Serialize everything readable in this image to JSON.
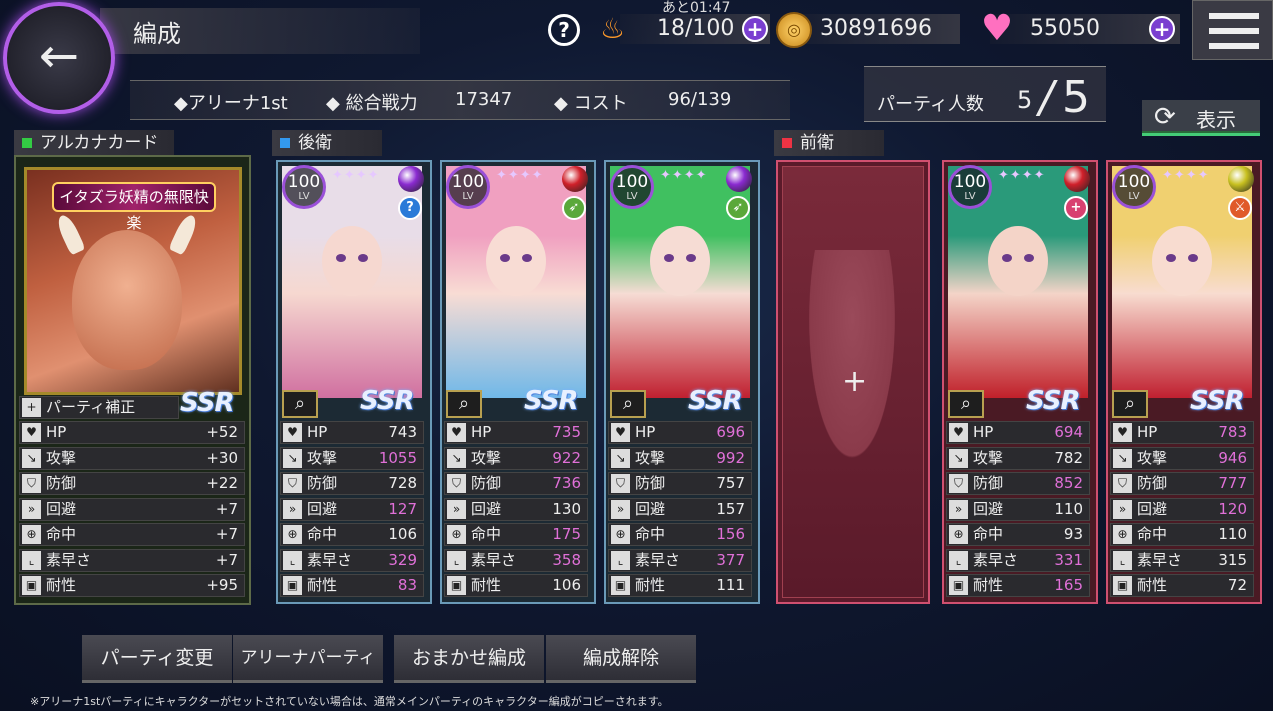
{
  "header": {
    "title": "編成",
    "stamina_timer": "あと01:47",
    "stamina": "18/100",
    "coins": "30891696",
    "gems": "55050"
  },
  "info": {
    "arena": "アリーナ1st",
    "power_label": "総合戦力",
    "power_value": "17347",
    "cost_label": "コスト",
    "cost_value": "96/139"
  },
  "party": {
    "label": "パーティ人数",
    "count": "5",
    "max": "5",
    "display_label": "表示"
  },
  "sections": {
    "arcana": "アルカナカード",
    "rear": "後衛",
    "front": "前衛"
  },
  "arcana": {
    "name": "イタズラ妖精の無限快楽",
    "rarity": "SSR",
    "bonus_label": "パーティ補正",
    "stats": [
      {
        "name": "HP",
        "value": "+52"
      },
      {
        "name": "攻撃",
        "value": "+30"
      },
      {
        "name": "防御",
        "value": "+22"
      },
      {
        "name": "回避",
        "value": "+7"
      },
      {
        "name": "命中",
        "value": "+7"
      },
      {
        "name": "素早さ",
        "value": "+7"
      },
      {
        "name": "耐性",
        "value": "+95"
      }
    ]
  },
  "stat_icons": [
    "heart-icon",
    "sword-icon",
    "shield-icon",
    "chevrons-icon",
    "crosshair-icon",
    "boot-icon",
    "resist-icon"
  ],
  "characters": [
    {
      "lv": "100",
      "lv_label": "LV",
      "rarity": "SSR",
      "orb_color": "#8a2ad0",
      "role_color": "#2a7ad8",
      "role": "?",
      "hair": "#e8dde8",
      "skin": "#f6d8d0",
      "accent": "#d070a0",
      "stats": [
        [
          "HP",
          "743",
          false
        ],
        [
          "攻撃",
          "1055",
          true
        ],
        [
          "防御",
          "728",
          false
        ],
        [
          "回避",
          "127",
          true
        ],
        [
          "命中",
          "106",
          false
        ],
        [
          "素早さ",
          "329",
          true
        ],
        [
          "耐性",
          "83",
          true
        ]
      ]
    },
    {
      "lv": "100",
      "lv_label": "LV",
      "rarity": "SSR",
      "orb_color": "#d0202a",
      "role_color": "#5aa83a",
      "role": "➶",
      "hair": "#f0a0c0",
      "skin": "#f8dcd4",
      "accent": "#70b8e8",
      "stats": [
        [
          "HP",
          "735",
          true
        ],
        [
          "攻撃",
          "922",
          true
        ],
        [
          "防御",
          "736",
          true
        ],
        [
          "回避",
          "130",
          false
        ],
        [
          "命中",
          "175",
          true
        ],
        [
          "素早さ",
          "358",
          true
        ],
        [
          "耐性",
          "106",
          false
        ]
      ]
    },
    {
      "lv": "100",
      "lv_label": "LV",
      "rarity": "SSR",
      "orb_color": "#8a2ad0",
      "role_color": "#5aa83a",
      "role": "➶",
      "hair": "#40c060",
      "skin": "#f6dcd4",
      "accent": "#c02030",
      "stats": [
        [
          "HP",
          "696",
          true
        ],
        [
          "攻撃",
          "992",
          true
        ],
        [
          "防御",
          "757",
          false
        ],
        [
          "回避",
          "157",
          false
        ],
        [
          "命中",
          "156",
          true
        ],
        [
          "素早さ",
          "377",
          true
        ],
        [
          "耐性",
          "111",
          false
        ]
      ]
    },
    {
      "lv": "100",
      "lv_label": "LV",
      "rarity": "SSR",
      "orb_color": "#d0202a",
      "role_color": "#d84070",
      "role": "+",
      "hair": "#2a9a7a",
      "skin": "#f4d4c8",
      "accent": "#c0202a",
      "stats": [
        [
          "HP",
          "694",
          true
        ],
        [
          "攻撃",
          "782",
          false
        ],
        [
          "防御",
          "852",
          true
        ],
        [
          "回避",
          "110",
          false
        ],
        [
          "命中",
          "93",
          false
        ],
        [
          "素早さ",
          "331",
          true
        ],
        [
          "耐性",
          "165",
          true
        ]
      ]
    },
    {
      "lv": "100",
      "lv_label": "LV",
      "rarity": "SSR",
      "orb_color": "#c8c020",
      "role_color": "#e05a2a",
      "role": "⚔",
      "hair": "#f0d070",
      "skin": "#f8dcd0",
      "accent": "#c02030",
      "stats": [
        [
          "HP",
          "783",
          true
        ],
        [
          "攻撃",
          "946",
          true
        ],
        [
          "防御",
          "777",
          true
        ],
        [
          "回避",
          "120",
          true
        ],
        [
          "命中",
          "110",
          false
        ],
        [
          "素早さ",
          "315",
          false
        ],
        [
          "耐性",
          "72",
          false
        ]
      ]
    }
  ],
  "buttons": {
    "party_change": "パーティ変更",
    "arena_party": "アリーナパーティ",
    "auto_form": "おまかせ編成",
    "clear_form": "編成解除"
  },
  "footnote": "※アリーナ1stパーティにキャラクターがセットされていない場合は、通常メインパーティのキャラクター編成がコピーされます。"
}
